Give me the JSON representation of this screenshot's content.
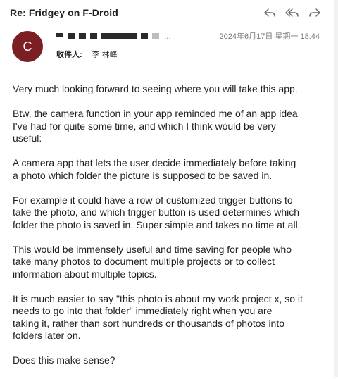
{
  "header": {
    "subject": "Re: Fridgey on F-Droid",
    "actions": [
      {
        "name": "reply-icon",
        "icon": "reply-arrow"
      },
      {
        "name": "reply-all-icon",
        "icon": "reply-all-arrow"
      },
      {
        "name": "forward-icon",
        "icon": "forward-arrow"
      }
    ]
  },
  "message": {
    "avatar_initial": "C",
    "avatar_color": "#7b1f24",
    "sender_ellipsis": "...",
    "date": "2024年6月17日 星期一 18:44",
    "recipients_label": "收件人:",
    "recipients_value": "李 林峰"
  },
  "body": {
    "paragraphs": [
      "Very much looking forward to seeing where you will take this app.",
      "Btw, the camera function in your app reminded me of an app idea\nI've had for quite some time, and which I think would be very\nuseful:",
      "A camera app that lets the user decide immediately before taking\na photo which folder the picture is supposed to be saved in.",
      "For example it could have a row of customized trigger buttons to\ntake the photo, and which trigger button is used determines which\nfolder the photo is saved in. Super simple and takes no time at all.",
      "This would be immensely useful and time saving for people who\ntake many photos to document multiple projects or to collect\ninformation about multiple topics.",
      "It is much easier to say \"this photo is about my work project x, so it\nneeds to go into that folder\" immediately right when you are\ntaking it, rather than sort hundreds or thousands of photos into\nfolders later on.",
      "Does this make sense?"
    ]
  }
}
